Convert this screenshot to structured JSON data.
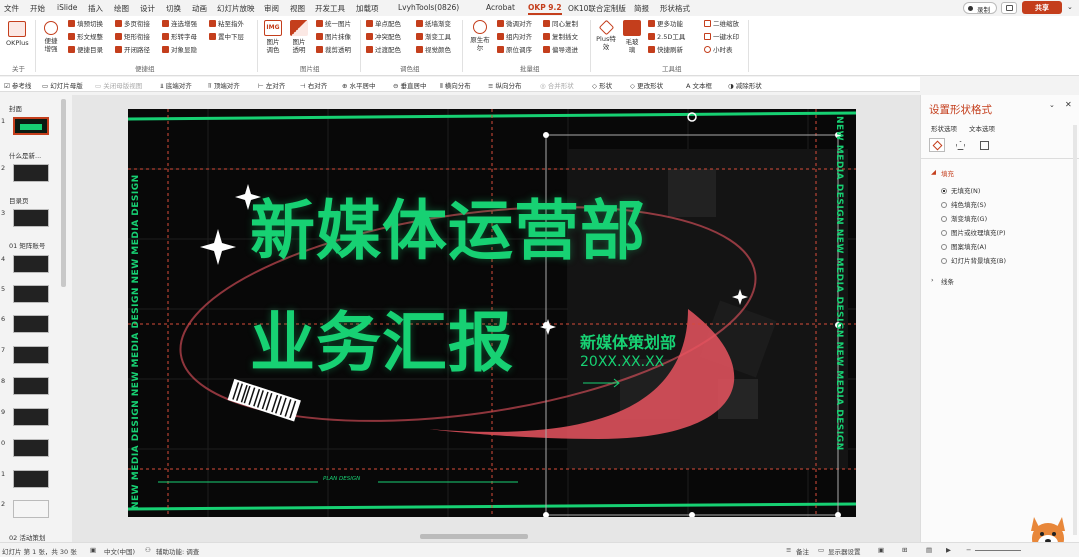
{
  "tabs": [
    "文件",
    "开始",
    "iSlide",
    "插入",
    "绘图",
    "设计",
    "切换",
    "动画",
    "幻灯片放映",
    "审阅",
    "视图",
    "开发工具",
    "加载项",
    "LvyhTools(0826)",
    "Acrobat",
    "OKP 9.2",
    "OK10联合定制版",
    "简报",
    "形状格式"
  ],
  "active_tab": "OKP 9.2",
  "top_right": {
    "record": "录制",
    "share": "共享"
  },
  "ribbon": {
    "okplus": "OKPlus",
    "about": "关于",
    "convenient": "便捷\n增强",
    "g1": [
      "填预切换",
      "形文规整",
      "便捷目录",
      "多页衔接",
      "矩形衔接",
      "开闭路径",
      "连选增强",
      "形转字母",
      "对象显隐",
      "粘至指外",
      "置中下层"
    ],
    "g1_label": "便捷组",
    "img": [
      "图片\n调色",
      "图片\n透明"
    ],
    "g2": [
      "统一图片",
      "图片抹像",
      "裁剪透明"
    ],
    "g2_label": "图片组",
    "g3": [
      "单点配色",
      "冲突配色",
      "过渡配色",
      "纸墙渐变",
      "渐变工具",
      "视觉颜色"
    ],
    "g3_label": "调色组",
    "orig": "原生布\n尔",
    "g4": [
      "微调对齐",
      "组内对齐",
      "原位调序",
      "同心复制",
      "复制插文",
      "偏导递进"
    ],
    "g4_label": "批量组",
    "plus": "Plus特\n效",
    "hair": "毛玻\n璃",
    "g5": [
      "更多功能",
      "2.5D工具",
      "快捷刷新",
      "二维缩放",
      "一键水印",
      "小时表"
    ],
    "g5_label": "工具组"
  },
  "quickbar": [
    "参考线",
    "幻灯片母版",
    "关闭母版视图",
    "底端对齐",
    "顶端对齐",
    "左对齐",
    "右对齐",
    "水平居中",
    "垂直居中",
    "横向分布",
    "纵向分布",
    "合并形状",
    "形状",
    "更改形状",
    "文本框",
    "减除形状"
  ],
  "thumbs": {
    "sections": [
      "封面",
      "什么是新...",
      "目录页",
      "01 矩阵账号",
      "02 活动策划"
    ],
    "slides": [
      "1",
      "2",
      "3",
      "4",
      "5",
      "6",
      "7",
      "8",
      "9",
      "0",
      "1",
      "2"
    ]
  },
  "slide": {
    "title1": "新媒体运营部",
    "title2": "业务汇报",
    "dept": "新媒体策划部",
    "date": "20XX.XX.XX",
    "side": "NEW MEDIA DESIGN NEW MEDIA DESIGN NEW MEDIA DESIGN",
    "bottom": "PLAN DESIGN",
    "accent": "#17d173"
  },
  "pane": {
    "title": "设置形状格式",
    "tab1": "形状选项",
    "tab2": "文本选项",
    "fill": "填充",
    "options": [
      "无填充(N)",
      "纯色填充(S)",
      "渐变填充(G)",
      "图片或纹理填充(P)",
      "图案填充(A)",
      "幻灯片背景填充(B)"
    ],
    "line": "线条"
  },
  "status": {
    "slide": "幻灯片 第 1 张，共 30 张",
    "lang": "中文(中国)",
    "access": "辅助功能: 调查",
    "notes": "备注",
    "display": "显示器设置"
  }
}
